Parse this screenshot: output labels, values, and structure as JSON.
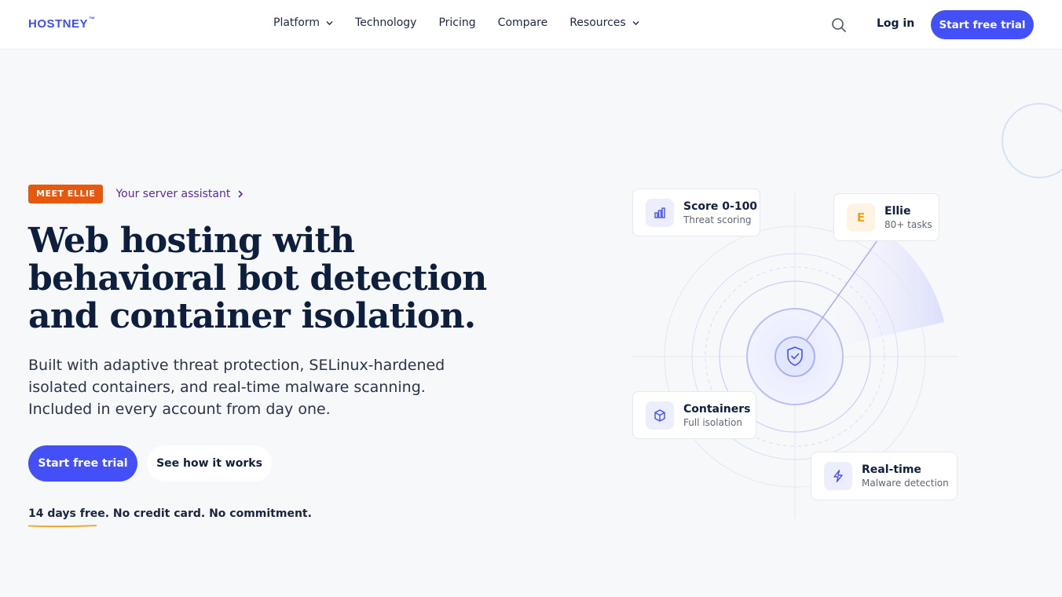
{
  "header": {
    "logo": "HOSTNEY",
    "logo_tm": "™",
    "nav": [
      {
        "label": "Platform",
        "dropdown": true
      },
      {
        "label": "Technology",
        "dropdown": false
      },
      {
        "label": "Pricing",
        "dropdown": false
      },
      {
        "label": "Compare",
        "dropdown": false
      },
      {
        "label": "Resources",
        "dropdown": true
      }
    ],
    "search_icon": "search-icon",
    "login": "Log in",
    "cta": "Start free trial"
  },
  "hero": {
    "badge": "MEET ELLIE",
    "badge_link": "Your server assistant",
    "title_lines": [
      "Web hosting with",
      "behavioral bot detection",
      "and container isolation."
    ],
    "subtitle_lines": [
      "Built with adaptive threat protection, SELinux-hardened",
      "isolated containers, and real-time malware scanning.",
      "Included in every account from day one."
    ],
    "cta_primary": "Start free trial",
    "cta_secondary": "See how it works",
    "fineprint": "14 days free. No credit card. No commitment."
  },
  "cards": {
    "score": {
      "title": "Score 0-100",
      "subtitle": "Threat scoring",
      "icon": "bar-chart-icon"
    },
    "ellie": {
      "title": "Ellie",
      "subtitle": "80+ tasks",
      "letter": "E"
    },
    "containers": {
      "title": "Containers",
      "subtitle": "Full isolation",
      "icon": "cube-icon"
    },
    "realtime": {
      "title": "Real-time",
      "subtitle": "Malware detection",
      "icon": "lightning-icon"
    }
  },
  "colors": {
    "accent": "#4350f8",
    "badge": "#e8580c",
    "link_purple": "#5b2aa0",
    "underline_orange": "#f0a020",
    "title_navy": "#0d1f3c"
  }
}
